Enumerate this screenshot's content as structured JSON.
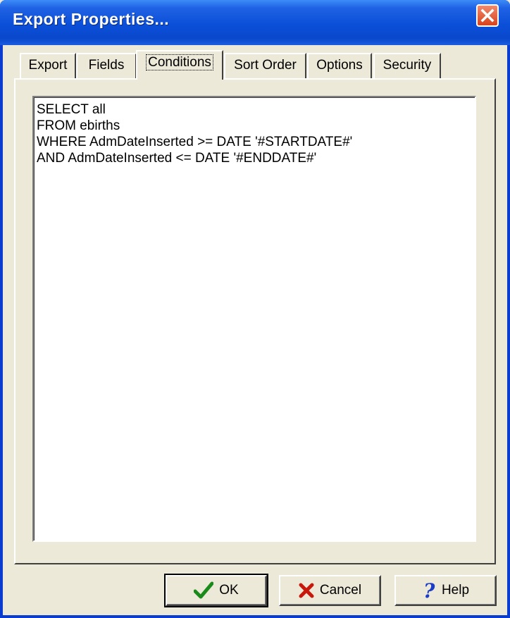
{
  "window": {
    "title": "Export Properties..."
  },
  "tabs": [
    {
      "label": "Export"
    },
    {
      "label": "Fields"
    },
    {
      "label": "Conditions"
    },
    {
      "label": "Sort Order"
    },
    {
      "label": "Options"
    },
    {
      "label": "Security"
    }
  ],
  "active_tab": "Conditions",
  "conditions": {
    "sql_lines": [
      "SELECT all",
      "FROM ebirths",
      "WHERE AdmDateInserted >= DATE '#STARTDATE#'",
      "AND AdmDateInserted <= DATE '#ENDDATE#'"
    ]
  },
  "buttons": {
    "ok_label": "OK",
    "cancel_label": "Cancel",
    "help_label": "Help"
  },
  "icons": {
    "close": "close-icon",
    "ok": "checkmark-icon",
    "cancel": "x-icon",
    "help": "question-mark-icon"
  },
  "colors": {
    "titlebar": "#0a48cc",
    "close_button": "#d8421c",
    "dialog_face": "#ece9d8",
    "ok_check": "#1a8a1a",
    "cancel_x": "#c8180c",
    "help_question": "#1a3cc8"
  }
}
